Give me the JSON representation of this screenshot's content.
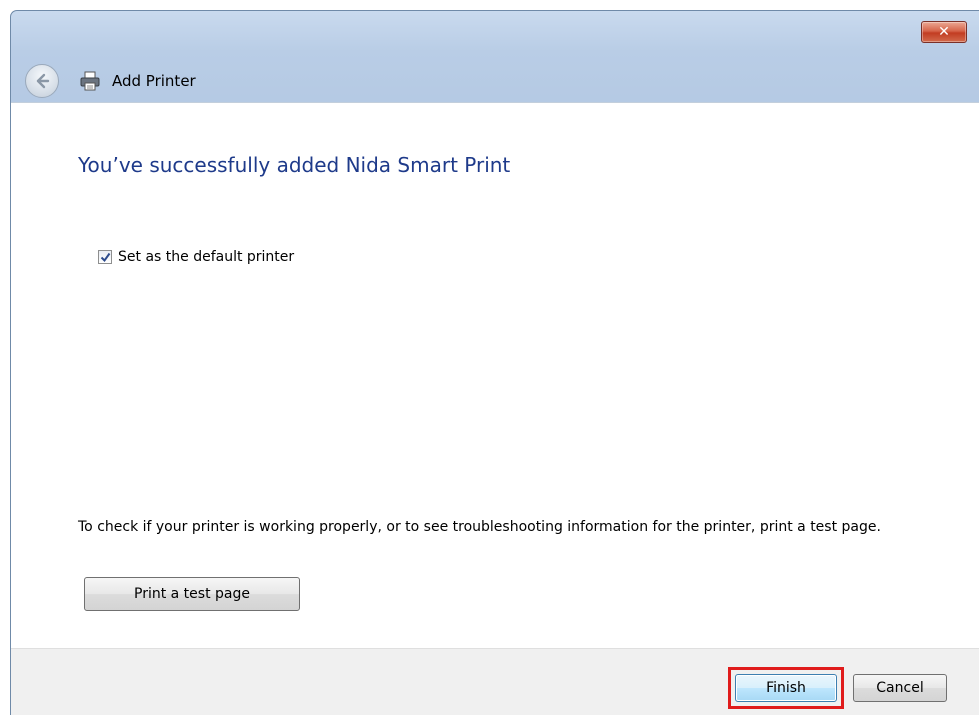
{
  "window": {
    "title": "Add Printer",
    "close_glyph": "✕"
  },
  "content": {
    "heading": "You’ve successfully added Nida Smart Print",
    "default_checkbox": {
      "label": "Set as the default printer",
      "checked": true
    },
    "info_text": "To check if your printer is working properly, or to see troubleshooting information for the printer, print a test page.",
    "test_page_button": "Print a test page"
  },
  "footer": {
    "finish_label": "Finish",
    "cancel_label": "Cancel"
  },
  "icons": {
    "back": "back-arrow-icon",
    "printer": "printer-icon",
    "close": "close-icon",
    "check": "checkmark-icon"
  },
  "colors": {
    "heading": "#1e3a8a",
    "highlight": "#e01b1b",
    "close_button": "#c23c22"
  }
}
